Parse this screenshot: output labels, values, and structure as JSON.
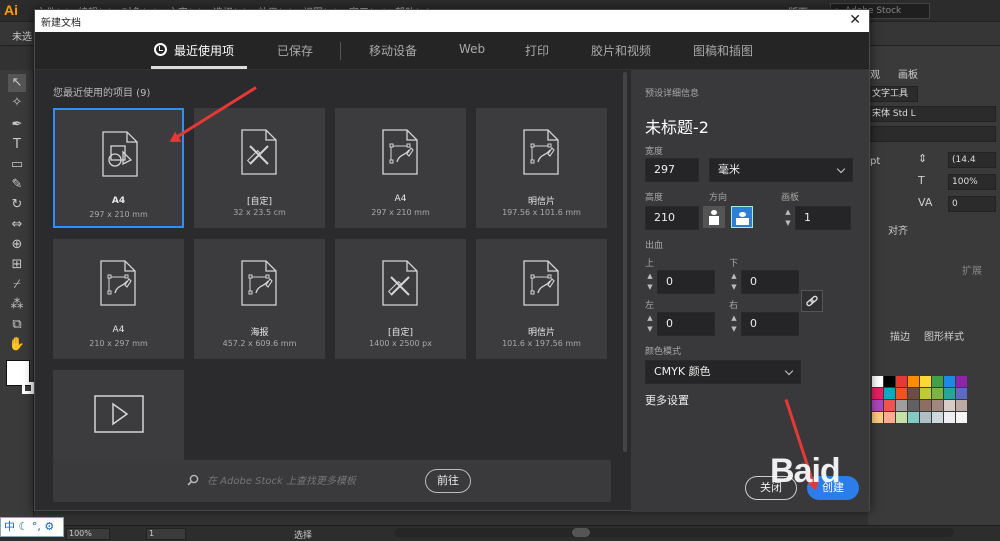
{
  "app": {
    "logo": "Ai",
    "menu": [
      "文件(F)",
      "编辑(E)",
      "对象(O)",
      "文字(T)",
      "选择(S)",
      "效果(C)",
      "视图(V)",
      "窗口(W)",
      "帮助(H)"
    ],
    "workspace": "版面",
    "stock_search_placeholder": "Adobe Stock",
    "control_unselected": "未选"
  },
  "dialog": {
    "title": "新建文档",
    "close_glyph": "✕",
    "tabs": [
      "最近使用项",
      "已保存",
      "移动设备",
      "Web",
      "打印",
      "胶片和视频",
      "图稿和插图"
    ],
    "active_tab": "最近使用项",
    "recent_header": "您最近使用的项目 (9)",
    "cards": [
      {
        "name": "A4",
        "size": "297 x 210 mm",
        "icon": "shapes-doc-icon",
        "selected": true
      },
      {
        "name": "[自定]",
        "size": "32 x 23.5 cm",
        "icon": "custom-doc-icon"
      },
      {
        "name": "A4",
        "size": "297 x 210 mm",
        "icon": "pen-doc-icon"
      },
      {
        "name": "明信片",
        "size": "197.56 x 101.6 mm",
        "icon": "pen-doc-icon"
      },
      {
        "name": "A4",
        "size": "210 x 297 mm",
        "icon": "pen-doc-icon"
      },
      {
        "name": "海报",
        "size": "457.2 x 609.6 mm",
        "icon": "pen-doc-icon"
      },
      {
        "name": "[自定]",
        "size": "1400 x 2500 px",
        "icon": "custom-doc-icon"
      },
      {
        "name": "明信片",
        "size": "101.6 x 197.56 mm",
        "icon": "pen-doc-icon"
      }
    ],
    "stock": {
      "placeholder": "在 Adobe Stock 上查找更多模板",
      "go_label": "前往"
    },
    "preset": {
      "header": "预设详细信息",
      "doc_title": "未标题-2",
      "width_label": "宽度",
      "width_value": "297",
      "unit": "毫米",
      "height_label": "高度",
      "height_value": "210",
      "orientation_label": "方向",
      "artboards_label": "画板",
      "artboards_value": "1",
      "bleed_label": "出血",
      "top_label": "上",
      "top_value": "0",
      "bottom_label": "下",
      "bottom_value": "0",
      "left_label": "左",
      "left_value": "0",
      "right_label": "右",
      "right_value": "0",
      "color_mode_label": "颜色模式",
      "color_mode_value": "CMYK 颜色",
      "more_settings": "更多设置",
      "close_btn": "关闭",
      "create_btn": "创建"
    }
  },
  "right_panel": {
    "tabs": [
      "观",
      "画板"
    ],
    "char_tool": "文字工具",
    "font": "宋体 Std L",
    "font_size": "(14.4",
    "unit_pt": "pt",
    "scale_h": "100%",
    "kerning": "0",
    "align_tab": "对齐",
    "align_btn": "扩展",
    "stroke_tab": "描边",
    "style_tab": "图形样式",
    "swatch_colors": [
      "#ffffff",
      "#000000",
      "#e53935",
      "#fb8c00",
      "#fdd835",
      "#43a047",
      "#1e88e5",
      "#8e24aa",
      "#e91e63",
      "#00acc1",
      "#f4511e",
      "#6d4c41",
      "#c0ca33",
      "#7cb342",
      "#26a69a",
      "#5c6bc0",
      "#ab47bc",
      "#ef5350",
      "#9e9e9e",
      "#616161",
      "#8d6e63",
      "#a1887f",
      "#d7ccc8",
      "#bcaaa4",
      "#ffcc80",
      "#ffab91",
      "#c5e1a5",
      "#80cbc4",
      "#b0bec5",
      "#cfd8dc",
      "#eceff1",
      "#f5f5f5"
    ]
  },
  "status": {
    "ime": "中 ☾ °, ⚙",
    "zoom": "100%",
    "artboard_index": "1",
    "tool": "选择"
  },
  "watermark": "Baid"
}
